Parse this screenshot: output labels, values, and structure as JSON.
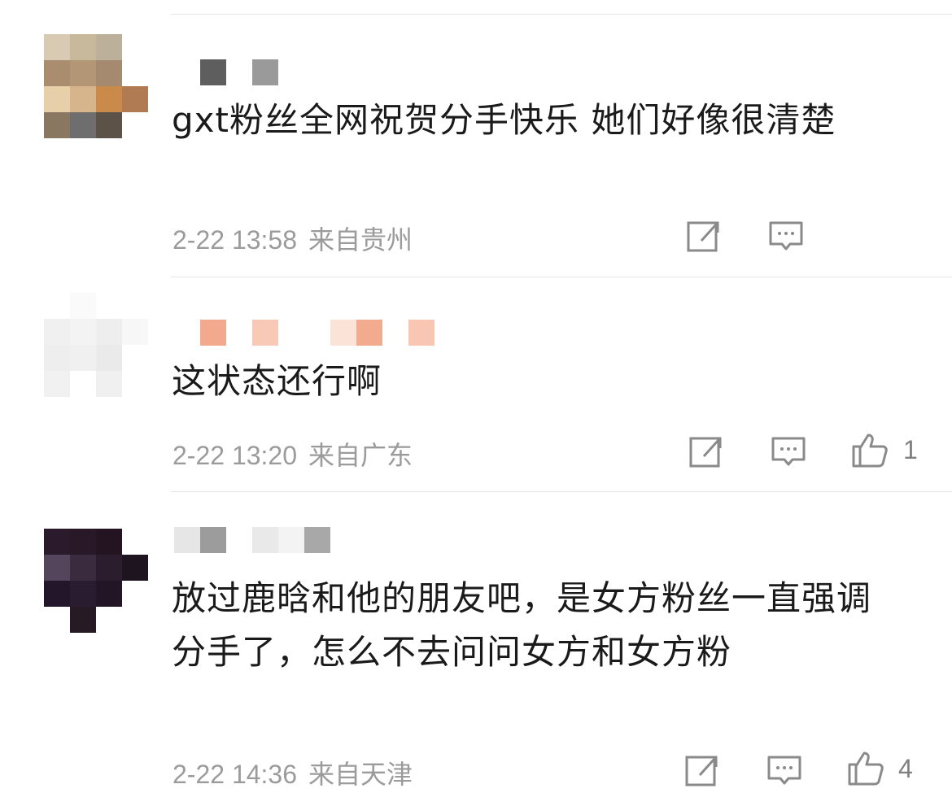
{
  "comments": [
    {
      "text": "gxt粉丝全网祝贺分手快乐 她们好像很清楚",
      "time": "2-22 13:58",
      "location": "来自贵州",
      "likes": ""
    },
    {
      "text": "这状态还行啊",
      "time": "2-22 13:20",
      "location": "来自广东",
      "likes": "1"
    },
    {
      "text": "放过鹿晗和他的朋友吧，是女方粉丝一直强调分手了，怎么不去问问女方和女方粉",
      "time": "2-22 14:36",
      "location": "来自天津",
      "likes": "4"
    }
  ],
  "icons": {
    "repost": "repost-icon",
    "reply": "comment-icon",
    "like": "thumbs-up-icon"
  },
  "colors": {
    "meta_text": "#9b9b9b",
    "icon_stroke": "#8a8a8a",
    "divider": "#e6e6e6"
  }
}
